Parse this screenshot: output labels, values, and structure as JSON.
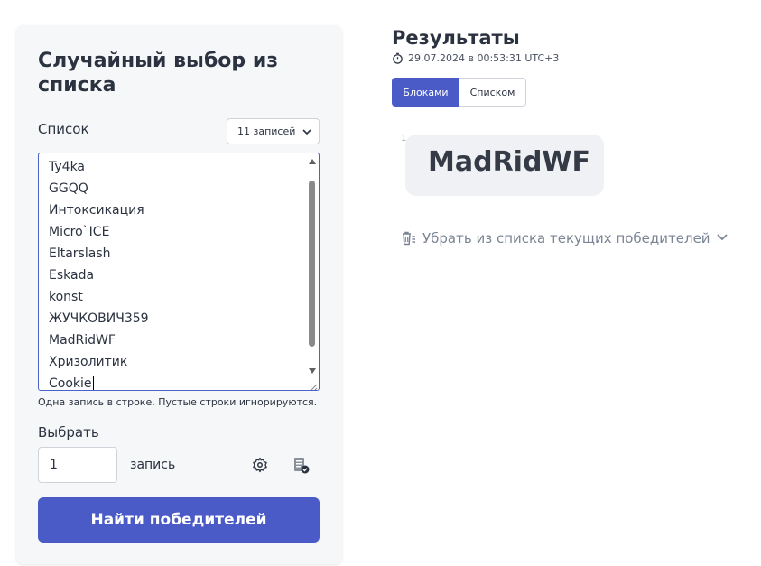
{
  "left_panel": {
    "title": "Случайный выбор из списка",
    "list_label": "Список",
    "count_dropdown": "11 записей",
    "entries": [
      "Ty4ka",
      "GGQQ",
      "Интоксикация",
      "Micro`ICE",
      "Eltarslash",
      "Eskada",
      "konst",
      "ЖУЧКОВИЧ359",
      "MadRidWF",
      "Хризолитик",
      "Cookie"
    ],
    "hint": "Одна запись в строке. Пустые строки игнорируются.",
    "choose_label": "Выбрать",
    "choose_value": "1",
    "unit_label": "запись",
    "find_button": "Найти победителей",
    "accent_color": "#4a5bc8"
  },
  "results": {
    "title": "Результаты",
    "timestamp": "29.07.2024 в 00:53:31 UTC+3",
    "tabs": [
      {
        "label": "Блоками",
        "active": true
      },
      {
        "label": "Списком",
        "active": false
      }
    ],
    "winners": [
      {
        "index": "1",
        "name": "MadRidWF"
      }
    ],
    "remove_winners_label": "Убрать из списка текущих победителей"
  }
}
